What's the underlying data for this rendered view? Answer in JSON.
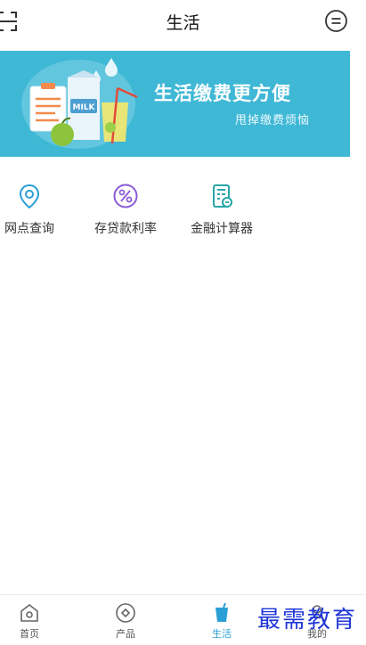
{
  "header": {
    "title": "生活"
  },
  "banner": {
    "title": "生活缴费更方便",
    "subtitle": "甩掉缴费烦恼",
    "carton_text": "MILK"
  },
  "entries": [
    {
      "label": "网点查询",
      "icon": "location-pin-icon"
    },
    {
      "label": "存贷款利率",
      "icon": "percent-icon"
    },
    {
      "label": "金融计算器",
      "icon": "calculator-icon"
    }
  ],
  "tabs": [
    {
      "label": "首页",
      "icon": "home-icon",
      "active": false
    },
    {
      "label": "产品",
      "icon": "product-icon",
      "active": false
    },
    {
      "label": "生活",
      "icon": "life-cup-icon",
      "active": true
    },
    {
      "label": "我的",
      "icon": "profile-icon",
      "active": false
    }
  ],
  "watermark": "最需教育",
  "colors": {
    "banner_bg": "#3fb8d6",
    "accent_blue": "#2a9fd6",
    "purple": "#8a5bd6",
    "teal": "#28a6a8"
  }
}
